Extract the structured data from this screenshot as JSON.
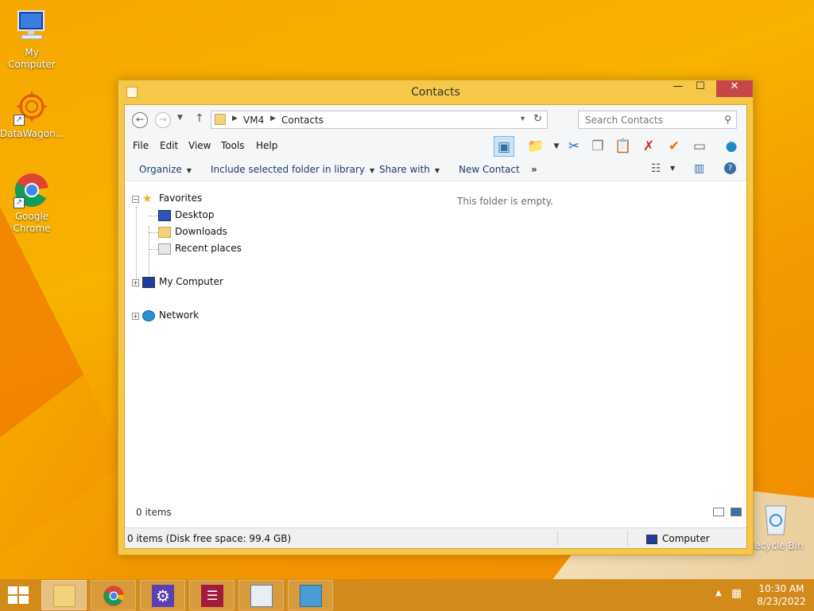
{
  "desktop": {
    "icons": [
      {
        "label": "My Computer"
      },
      {
        "label": "DataWagon..."
      },
      {
        "label": "Google\nChrome",
        "line1": "Google",
        "line2": "Chrome"
      },
      {
        "label": "Recycle Bin"
      }
    ]
  },
  "window": {
    "title": "Contacts",
    "controls": {
      "minimize": "—",
      "maximize": "☐",
      "close": "✕"
    },
    "address": {
      "crumbs": [
        "VM4",
        "Contacts"
      ]
    },
    "search": {
      "placeholder": "Search Contacts"
    },
    "menu": [
      "File",
      "Edit",
      "View",
      "Tools",
      "Help"
    ],
    "commands": {
      "organize": "Organize",
      "include": "Include selected folder in library",
      "share": "Share with",
      "new_contact": "New Contact",
      "more": "»"
    },
    "tree": {
      "favorites": "Favorites",
      "desktop": "Desktop",
      "downloads": "Downloads",
      "recent": "Recent places",
      "computer": "My Computer",
      "network": "Network"
    },
    "empty_message": "This folder is empty.",
    "items_count": "0 items",
    "status": {
      "left": "0 items (Disk free space: 99.4 GB)",
      "right": "Computer"
    }
  },
  "taskbar": {
    "clock_time": "10:30 AM",
    "clock_date": "8/23/2022"
  },
  "colors": {
    "accent": "#f6c84a",
    "close": "#c74749",
    "taskbar": "#d28a1a"
  }
}
